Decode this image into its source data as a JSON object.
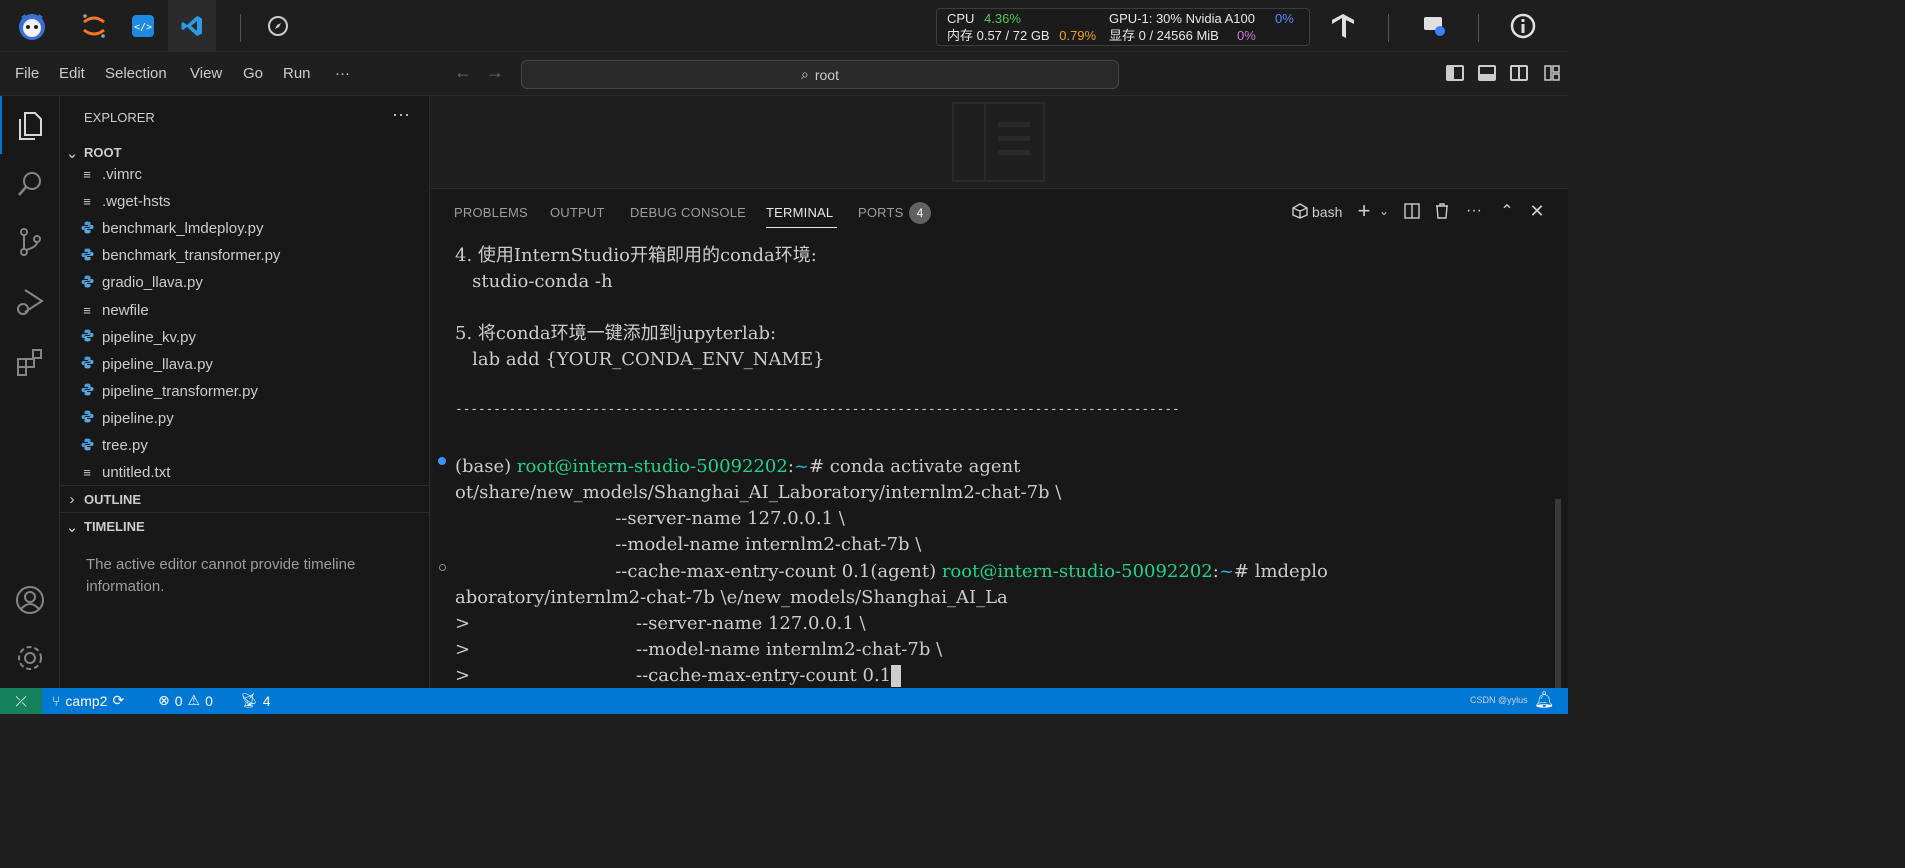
{
  "host": {
    "stats": {
      "cpu_label": "CPU",
      "cpu_val": "4.36%",
      "mem_label": "内存 0.57 / 72 GB",
      "mem_val": "0.79%",
      "gpu_label": "GPU-1: 30% Nvidia A100",
      "gpu_val": "0%",
      "vram_label": "显存 0 / 24566 MiB",
      "vram_val": "0%"
    }
  },
  "menu": [
    "File",
    "Edit",
    "Selection",
    "View",
    "Go",
    "Run",
    "···"
  ],
  "command_center": {
    "label": "root"
  },
  "sidebar": {
    "title": "EXPLORER",
    "root": "ROOT",
    "files": [
      {
        "name": ".vimrc",
        "icon": "≡"
      },
      {
        "name": ".wget-hsts",
        "icon": "≡"
      },
      {
        "name": "benchmark_lmdeploy.py",
        "icon": "py"
      },
      {
        "name": "benchmark_transformer.py",
        "icon": "py"
      },
      {
        "name": "gradio_llava.py",
        "icon": "py"
      },
      {
        "name": "newfile",
        "icon": "≡"
      },
      {
        "name": "pipeline_kv.py",
        "icon": "py"
      },
      {
        "name": "pipeline_llava.py",
        "icon": "py"
      },
      {
        "name": "pipeline_transformer.py",
        "icon": "py"
      },
      {
        "name": "pipeline.py",
        "icon": "py"
      },
      {
        "name": "tree.py",
        "icon": "py"
      },
      {
        "name": "untitled.txt",
        "icon": "≡"
      }
    ],
    "outline": "OUTLINE",
    "timeline": "TIMELINE",
    "timeline_msg": "The active editor cannot provide timeline information."
  },
  "panel": {
    "tabs": [
      "PROBLEMS",
      "OUTPUT",
      "DEBUG CONSOLE",
      "TERMINAL",
      "PORTS"
    ],
    "ports_badge": "4",
    "shell": "bash"
  },
  "terminal": {
    "l1": "4. 使用InternStudio开箱即用的conda环境:",
    "l2": "   studio-conda -h",
    "l3": "5. 将conda环境一键添加到jupyterlab:",
    "l4": "   lab add {YOUR_CONDA_ENV_NAME}",
    "sep": "-----------------------------------------------------------------------------------------------",
    "p1_a": "(base) ",
    "p1_user": "root@intern-studio-50092202",
    "p1_colon": ":",
    "p1_tilde": "~",
    "p1_cmd": "# conda activate agent",
    "l5": "ot/share/new_models/Shanghai_AI_Laboratory/internlm2-chat-7b \\",
    "l6": "                            --server-name 127.0.0.1 \\",
    "l7": "                            --model-name internlm2-chat-7b \\",
    "l8_a": "                            --cache-max-entry-count 0.1(agent) ",
    "l8_user": "root@intern-studio-50092202",
    "l8_colon": ":",
    "l8_tilde": "~",
    "l8_cmd": "# lmdeplo",
    "l9": "aboratory/internlm2-chat-7b \\e/new_models/Shanghai_AI_La",
    "l10": ">                             --server-name 127.0.0.1 \\",
    "l11": ">                             --model-name internlm2-chat-7b \\",
    "l12": ">                             --cache-max-entry-count 0.1"
  },
  "status": {
    "branch": "camp2",
    "errors": "0",
    "warnings": "0",
    "ports": "4",
    "watermark": "CSDN @yylus"
  }
}
